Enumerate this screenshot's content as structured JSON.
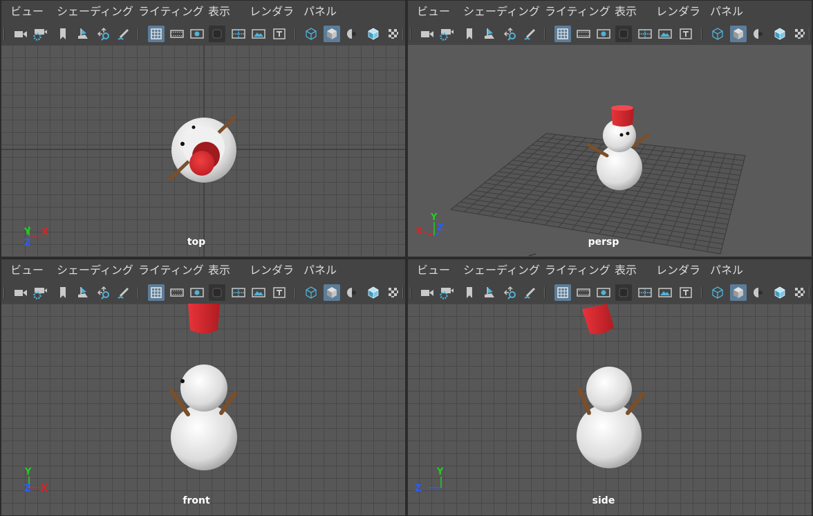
{
  "menu": [
    "ビュー",
    "シェーディング",
    "ライティング",
    "表示",
    "レンダラ",
    "パネル"
  ],
  "toolbar": {
    "icons": [
      "camera-icon",
      "camera-attributes-icon",
      "bookmark-icon",
      "image-plane-icon",
      "two-d-pan-zoom-icon",
      "grease-pencil-icon",
      "grid-icon",
      "film-gate-icon",
      "resolution-gate-icon",
      "gate-mask-icon",
      "field-chart-icon",
      "safe-action-icon",
      "safe-title-icon",
      "wireframe-icon",
      "smooth-shade-icon",
      "use-default-material-icon",
      "wireframe-on-shaded-icon",
      "xray-icon"
    ],
    "toggled_on": [
      "grid-icon",
      "smooth-shade-icon"
    ]
  },
  "axis": {
    "x": "X",
    "y": "Y",
    "z": "Z"
  },
  "colors": {
    "axis_x": "#e02020",
    "axis_y": "#20d020",
    "axis_z": "#2a5cff",
    "hat": "#d8262c",
    "stick": "#7a4f2a",
    "snow": "#e8e8e8",
    "toolbar_active": "#5c7d99"
  },
  "panels": [
    {
      "camera": "top"
    },
    {
      "camera": "persp"
    },
    {
      "camera": "front"
    },
    {
      "camera": "side"
    }
  ]
}
